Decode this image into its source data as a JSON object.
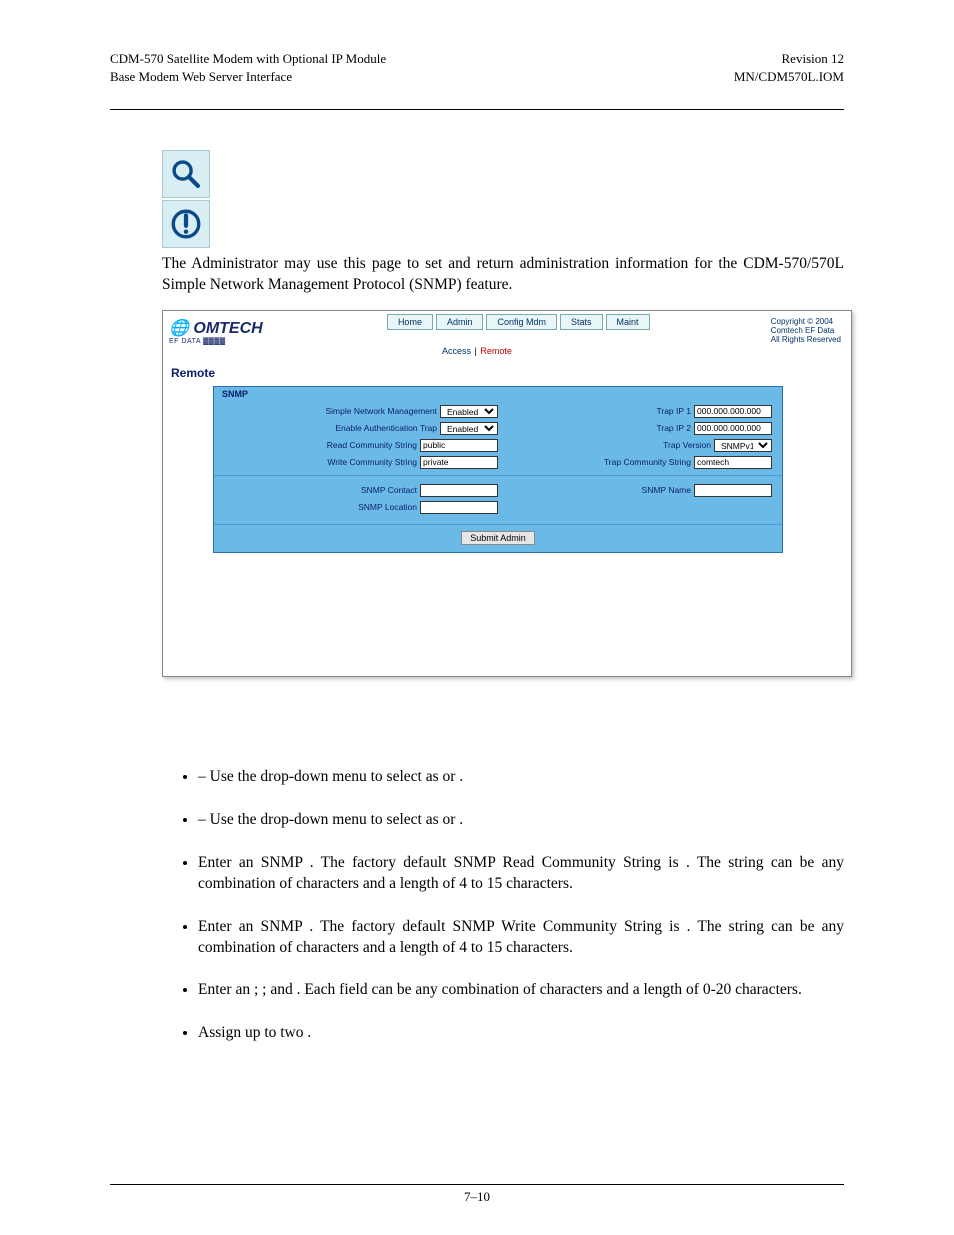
{
  "header": {
    "left1": "CDM-570 Satellite Modem with Optional IP Module",
    "left2": "Base Modem Web Server Interface",
    "right1": "Revision 12",
    "right2": "MN/CDM570L.IOM"
  },
  "intro": "The Administrator may use this page to set and return administration information for the CDM-570/570L Simple Network Management Protocol (SNMP) feature.",
  "shot": {
    "logo_main": "OMTECH",
    "logo_sub": "EF DATA ▓▓▓▓",
    "tabs": [
      "Home",
      "Admin",
      "Config Mdm",
      "Stats",
      "Maint"
    ],
    "copyright": [
      "Copyright © 2004",
      "Comtech EF Data",
      "All Rights Reserved"
    ],
    "subnav": {
      "access": "Access",
      "sep": " | ",
      "remote": "Remote"
    },
    "section": "Remote",
    "panel_title": "SNMP",
    "left_fields": {
      "snm_label": "Simple Network Management",
      "snm_value": "Enabled",
      "auth_label": "Enable Authentication Trap",
      "auth_value": "Enabled",
      "read_label": "Read Community String",
      "read_value": "public",
      "write_label": "Write Community String",
      "write_value": "private"
    },
    "right_fields": {
      "trap1_label": "Trap IP 1",
      "trap1_value": "000.000.000.000",
      "trap2_label": "Trap IP 2",
      "trap2_value": "000.000.000.000",
      "ver_label": "Trap Version",
      "ver_value": "SNMPv1",
      "trapcs_label": "Trap Community String",
      "trapcs_value": "comtech"
    },
    "lower": {
      "contact_label": "SNMP Contact",
      "contact_value": "",
      "name_label": "SNMP Name",
      "name_value": "",
      "loc_label": "SNMP Location",
      "loc_value": ""
    },
    "submit": "Submit Admin"
  },
  "bullets": {
    "b1a": " – Use the drop-down menu to select as ",
    "b1b": " or ",
    "b1c": ".",
    "b2a": " – Use the drop-down menu to select as ",
    "b2b": " or ",
    "b2c": ".",
    "b3a": "Enter an SNMP ",
    "b3b": ". The factory default SNMP Read Community String is ",
    "b3c": ". The string can be any combination of characters and a length of 4 to 15 characters.",
    "b4a": "Enter an SNMP ",
    "b4b": ". The factory default SNMP Write Community String is ",
    "b4c": ". The string can be any combination of characters and a length of 4 to 15 characters.",
    "b5a": "Enter an ",
    "b5b": "; ",
    "b5c": "; and ",
    "b5d": ". Each field can be any combination of characters and a length of 0-20 characters.",
    "b6a": "Assign up to two ",
    "b6b": "."
  },
  "footer": "7–10"
}
